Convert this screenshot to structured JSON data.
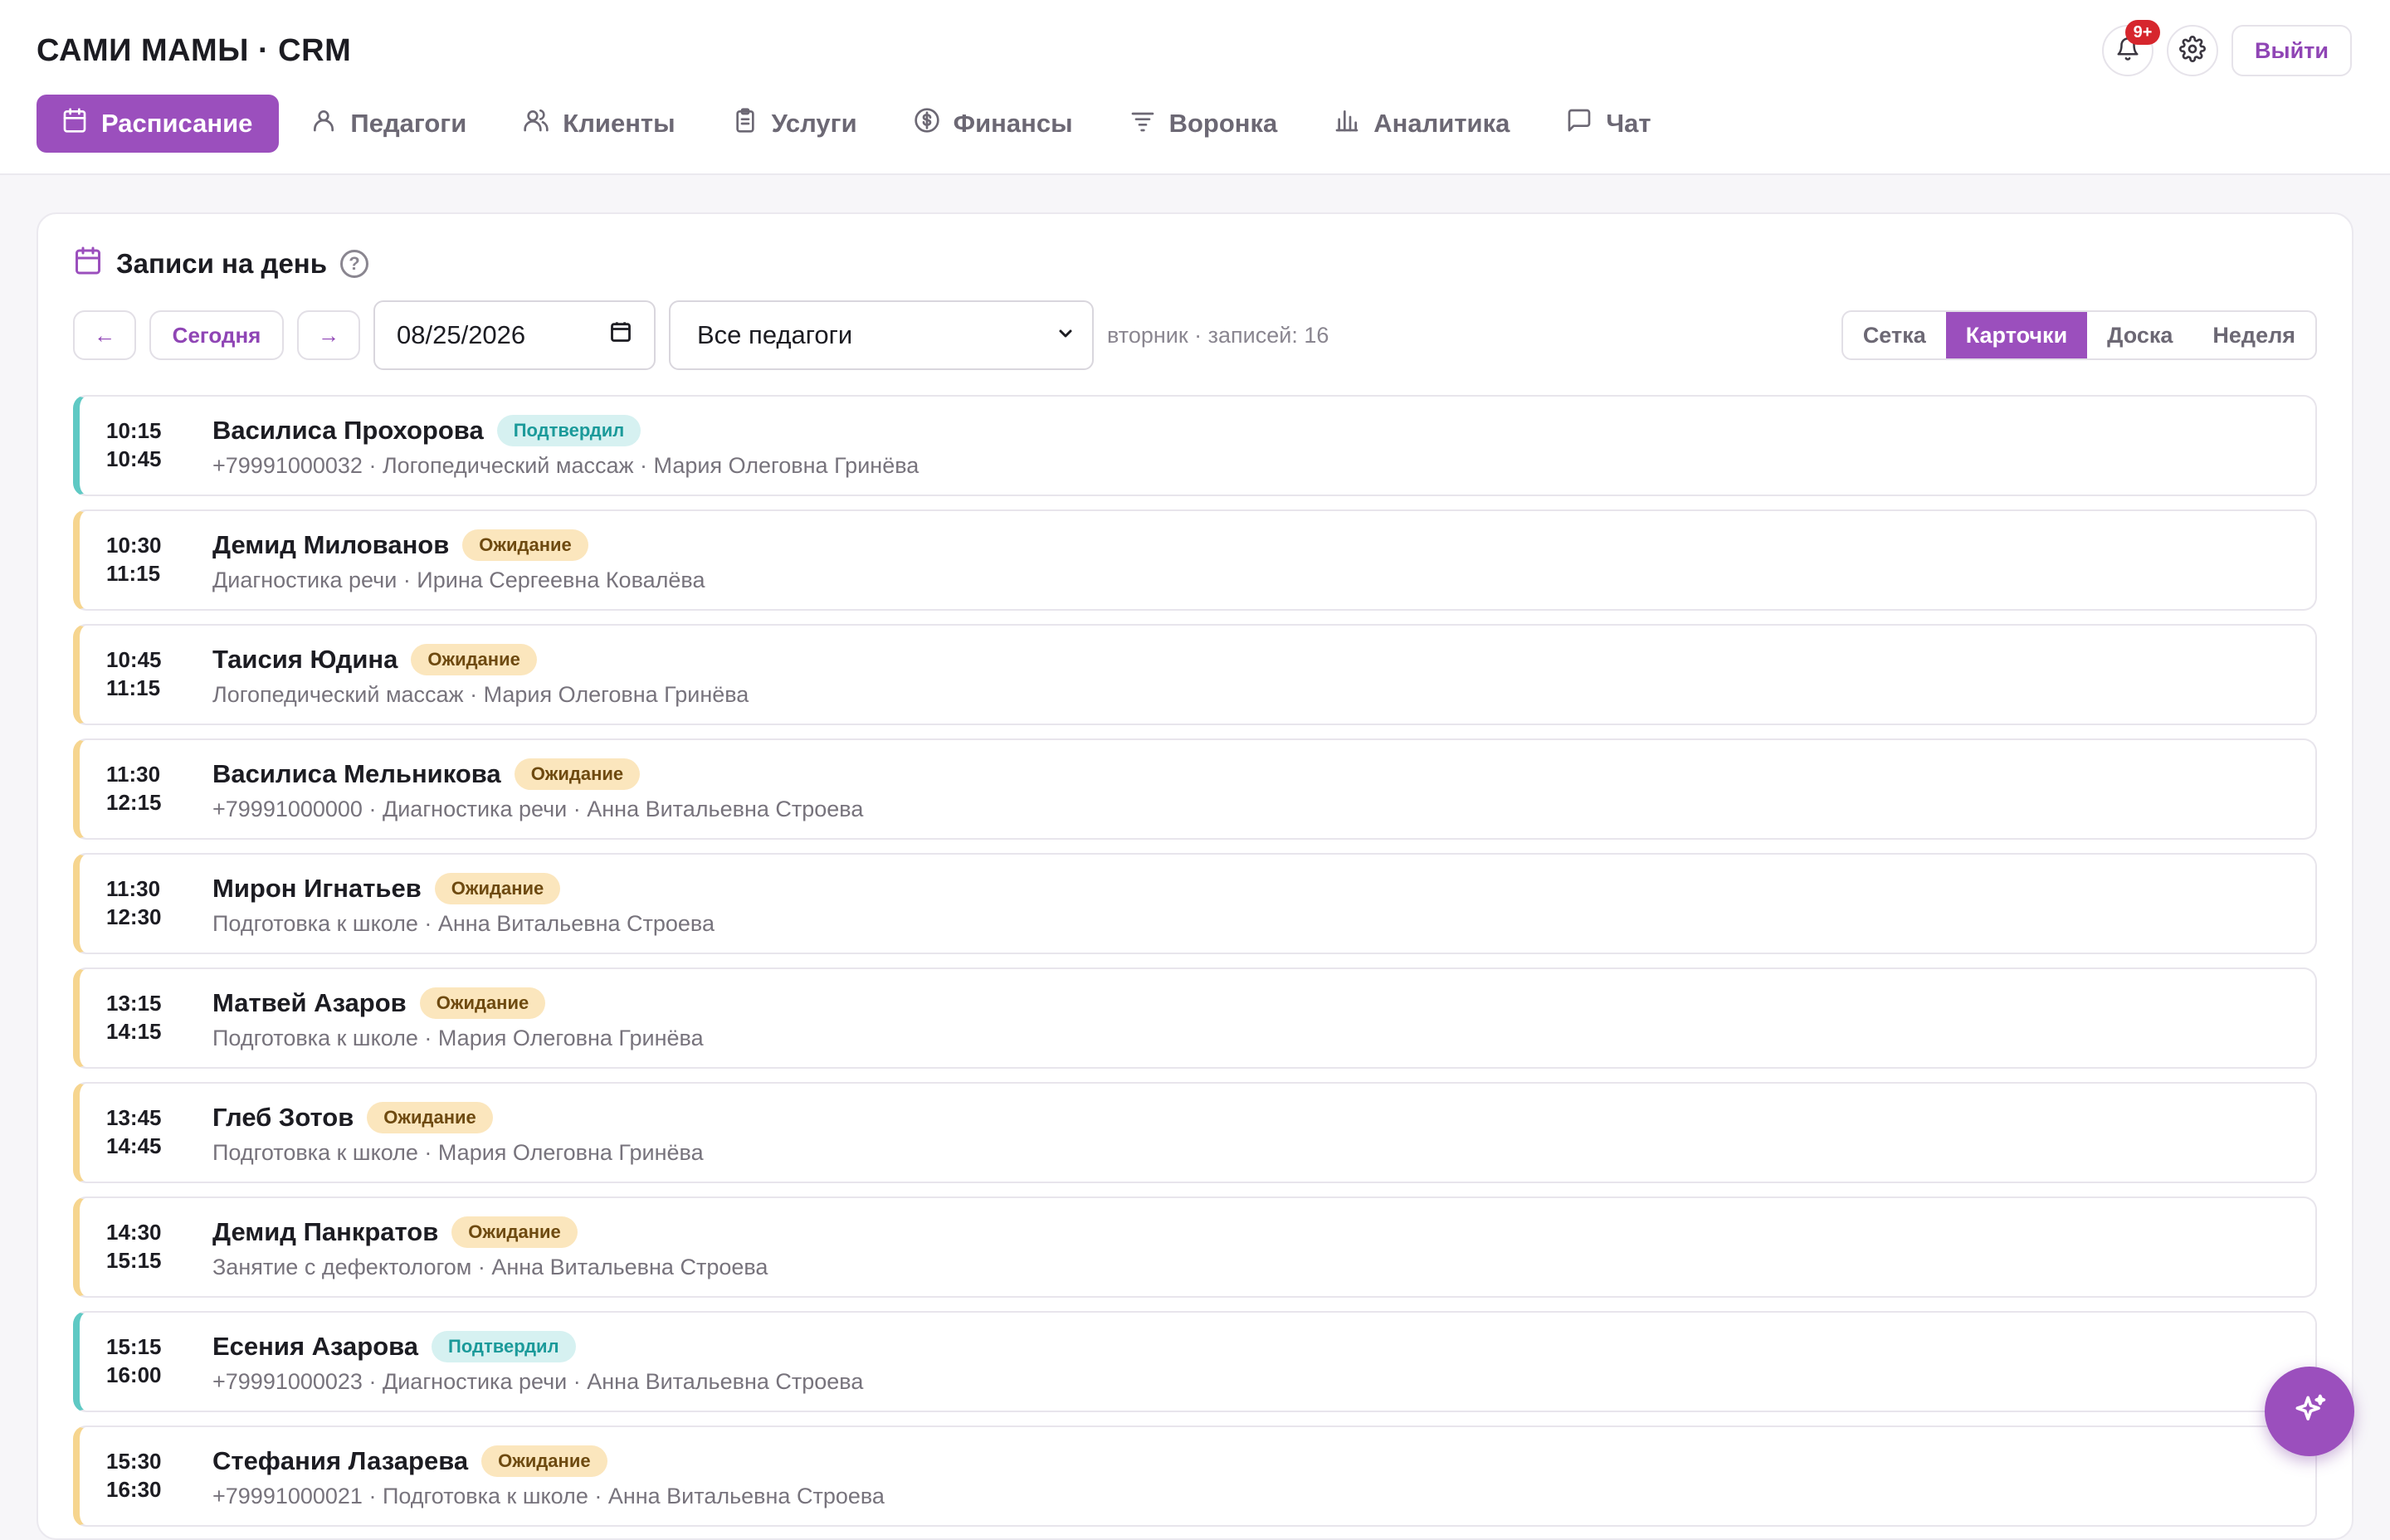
{
  "app": {
    "title": "САМИ МАМЫ · CRM"
  },
  "header": {
    "notifications_badge": "9+",
    "logout_label": "Выйти"
  },
  "nav": [
    {
      "label": "Расписание",
      "icon": "calendar-icon",
      "active": true
    },
    {
      "label": "Педагоги",
      "icon": "user-icon"
    },
    {
      "label": "Клиенты",
      "icon": "users-icon"
    },
    {
      "label": "Услуги",
      "icon": "clipboard-icon"
    },
    {
      "label": "Финансы",
      "icon": "dollar-icon"
    },
    {
      "label": "Воронка",
      "icon": "filter-icon"
    },
    {
      "label": "Аналитика",
      "icon": "bar-chart-icon"
    },
    {
      "label": "Чат",
      "icon": "chat-icon"
    }
  ],
  "panel": {
    "title": "Записи на день",
    "help_icon": "?",
    "today_label": "Сегодня",
    "prev_arrow": "←",
    "next_arrow": "→",
    "date_value": "08/25/2026",
    "teacher_select": "Все педагоги",
    "day_info": "вторник · записей: 16",
    "view_modes": [
      "Сетка",
      "Карточки",
      "Доска",
      "Неделя"
    ],
    "active_view": "Карточки"
  },
  "colors": {
    "accent": "#9b4fbd",
    "waiting_stripe": "#f6d58f",
    "confirmed_stripe": "#5fc9c4"
  },
  "appointments": [
    {
      "start": "10:15",
      "end": "10:45",
      "name": "Василиса Прохорова",
      "status": "Подтвердил",
      "details": "+79991000032 · Логопедический массаж · Мария Олеговна Гринёва"
    },
    {
      "start": "10:30",
      "end": "11:15",
      "name": "Демид Милованов",
      "status": "Ожидание",
      "details": "Диагностика речи · Ирина Сергеевна Ковалёва"
    },
    {
      "start": "10:45",
      "end": "11:15",
      "name": "Таисия Юдина",
      "status": "Ожидание",
      "details": "Логопедический массаж · Мария Олеговна Гринёва"
    },
    {
      "start": "11:30",
      "end": "12:15",
      "name": "Василиса Мельникова",
      "status": "Ожидание",
      "details": "+79991000000 · Диагностика речи · Анна Витальевна Строева"
    },
    {
      "start": "11:30",
      "end": "12:30",
      "name": "Мирон Игнатьев",
      "status": "Ожидание",
      "details": "Подготовка к школе · Анна Витальевна Строева"
    },
    {
      "start": "13:15",
      "end": "14:15",
      "name": "Матвей Азаров",
      "status": "Ожидание",
      "details": "Подготовка к школе · Мария Олеговна Гринёва"
    },
    {
      "start": "13:45",
      "end": "14:45",
      "name": "Глеб Зотов",
      "status": "Ожидание",
      "details": "Подготовка к школе · Мария Олеговна Гринёва"
    },
    {
      "start": "14:30",
      "end": "15:15",
      "name": "Демид Панкратов",
      "status": "Ожидание",
      "details": "Занятие с дефектологом · Анна Витальевна Строева"
    },
    {
      "start": "15:15",
      "end": "16:00",
      "name": "Есения Азарова",
      "status": "Подтвердил",
      "details": "+79991000023 · Диагностика речи · Анна Витальевна Строева"
    },
    {
      "start": "15:30",
      "end": "16:30",
      "name": "Стефания Лазарева",
      "status": "Ожидание",
      "details": "+79991000021 · Подготовка к школе · Анна Витальевна Строева"
    }
  ]
}
